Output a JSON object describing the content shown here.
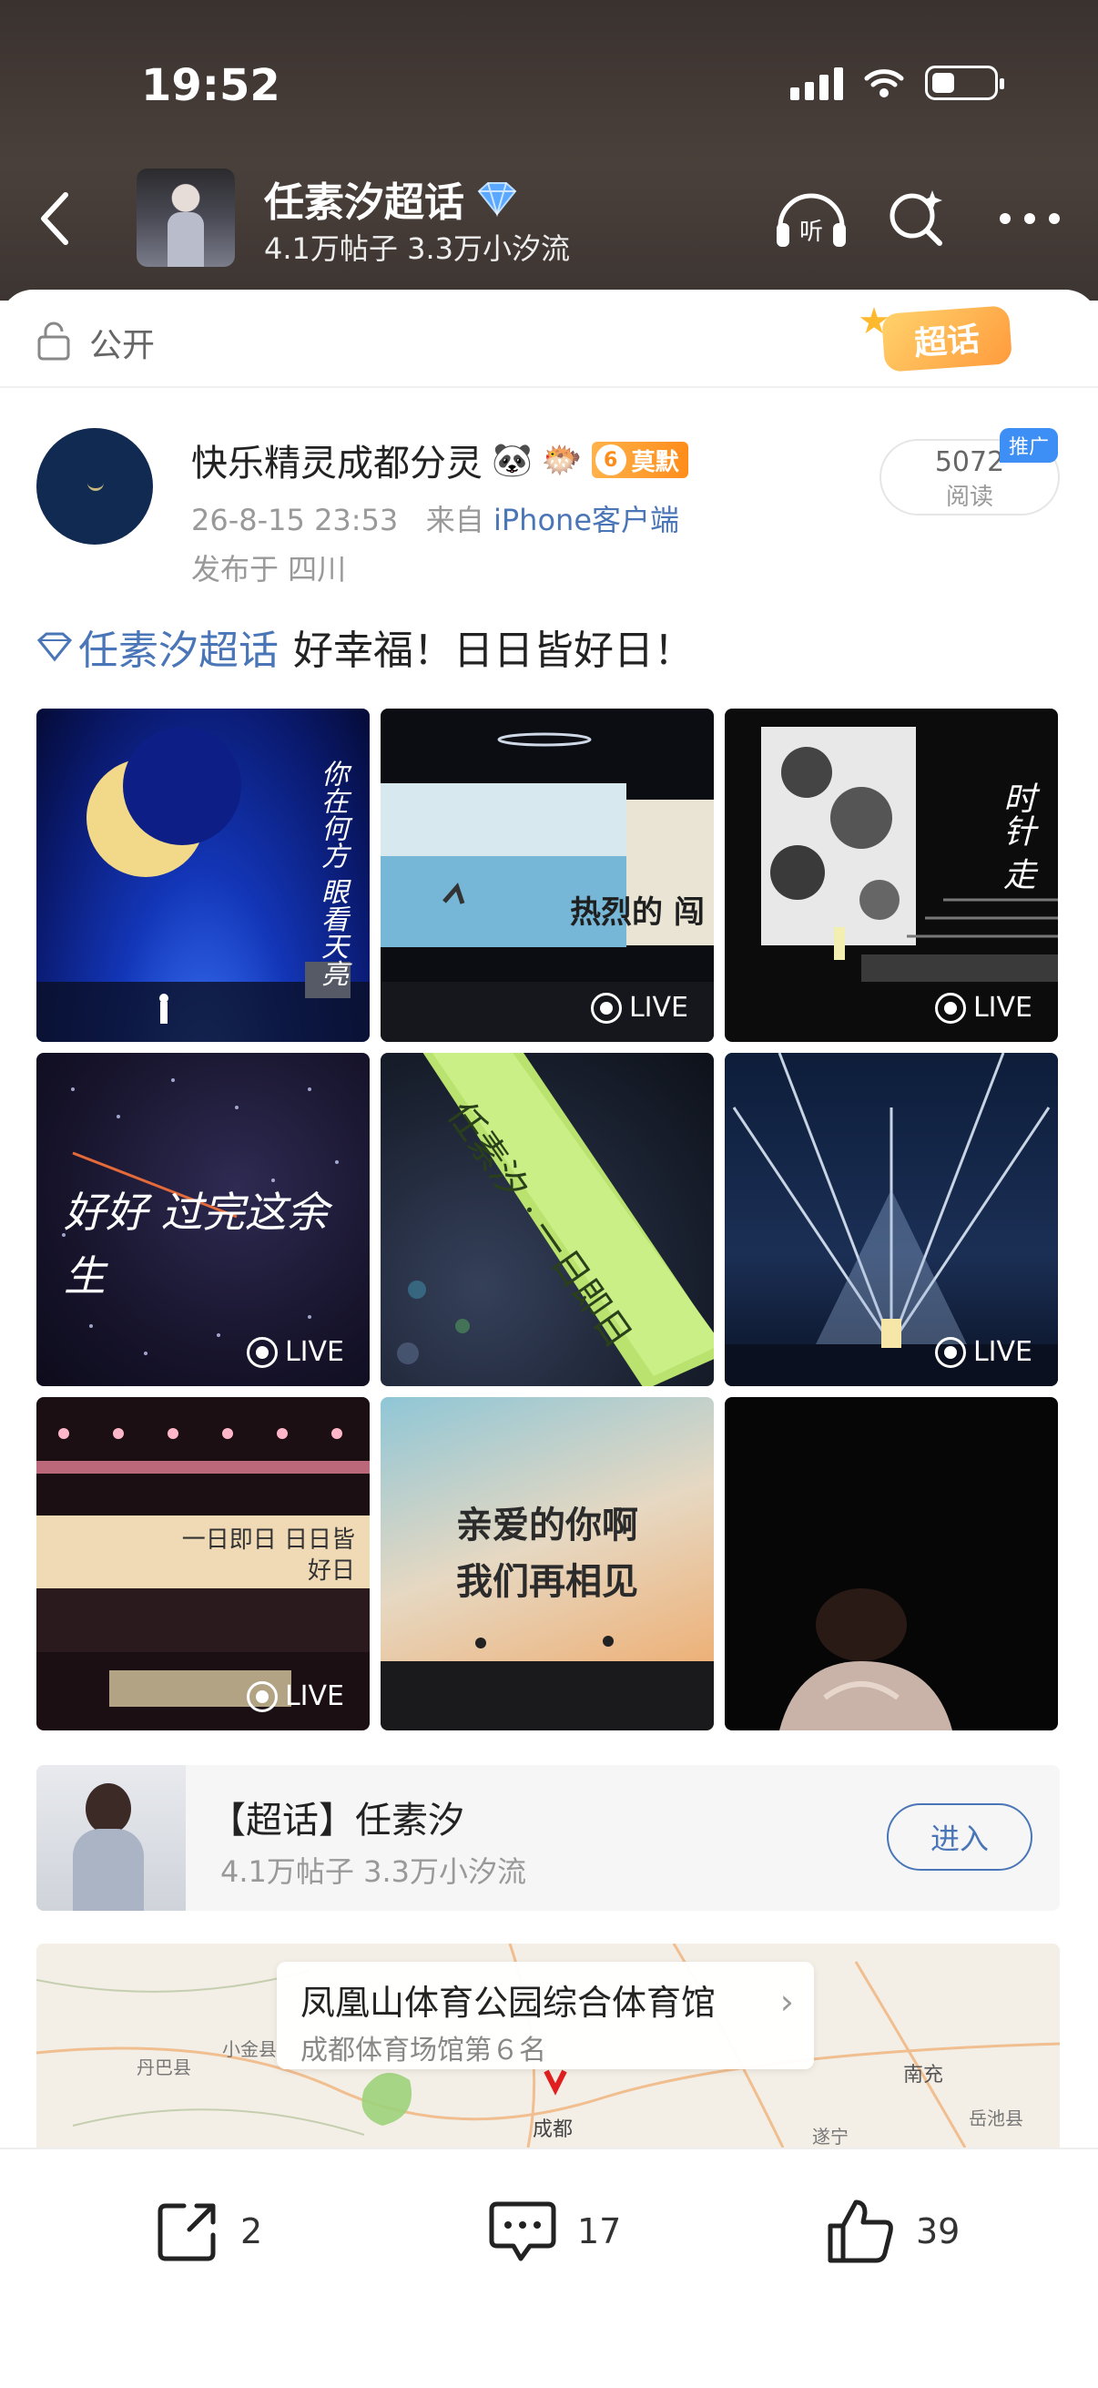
{
  "status": {
    "time": "19:52"
  },
  "header": {
    "title": "任素汐超话",
    "posts": "4.1万帖子",
    "fans": "3.3万小汐流"
  },
  "visibility": {
    "label": "公开",
    "badge": "超话"
  },
  "post": {
    "author": "快乐精灵成都分灵",
    "emoji1": "🐼",
    "emoji2": "🐡",
    "level": "6",
    "level_title": "莫默",
    "date": "26-8-15 23:53",
    "source_prefix": "来自",
    "source": "iPhone客户端",
    "location": "发布于 四川",
    "reads": "5072",
    "reads_label": "阅读",
    "promo": "推广",
    "topic_tag": "任素汐超话",
    "text": "好幸福！日日皆好日！",
    "live_label": "LIVE",
    "photo_texts": {
      "p1": "你在何方 眼看天亮",
      "p2": "热烈的 闯",
      "p3": "时针 走",
      "p4": "好好 过完这余生",
      "p5": "任素汐 · 一日即日",
      "p7": "一日即日 日日皆好日",
      "p8a": "亲爱的你啊",
      "p8b": "我们再相见"
    }
  },
  "topic_card": {
    "title": "【超话】任素汐",
    "posts": "4.1万帖子",
    "fans": "3.3万小汐流",
    "enter": "进入"
  },
  "map": {
    "venue": "凤凰山体育公园综合体育馆",
    "rank": "成都体育场馆第６名",
    "labels": [
      "丹巴县",
      "小金县",
      "成都",
      "南充",
      "遂宁",
      "岳池县"
    ]
  },
  "actions": {
    "shares": "2",
    "comments": "17",
    "likes": "39"
  },
  "colors": {
    "link": "#4a76b8",
    "header_bg": "#3f3733",
    "badge_orange": "#ff9b3d"
  }
}
